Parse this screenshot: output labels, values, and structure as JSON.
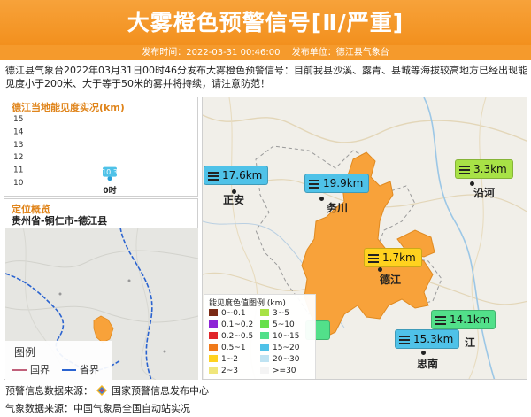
{
  "header": {
    "title": "大雾橙色预警信号[Ⅱ/严重]",
    "publish_time": "发布时间：2022-03-31 00:46:00",
    "publish_unit": "发布单位：德江县气象台"
  },
  "description": "德江县气象台2022年03月31日00时46分发布大雾橙色预警信号：目前我县沙溪、露青、县城等海拔较高地方已经出现能见度小于200米、大于等于50米的雾并将持续，请注意防范！",
  "visibility_panel": {
    "title": "德江当地能见度实况(km)",
    "chart_data": {
      "type": "line",
      "title": "德江当地能见度实况(km)",
      "categories": [
        "0时"
      ],
      "values": [
        10.3
      ],
      "yticks": [
        15,
        14,
        13,
        12,
        11,
        10
      ],
      "ylim": [
        10,
        15
      ],
      "grid": false
    }
  },
  "location_panel": {
    "title": "定位概览",
    "region": "贵州省-铜仁市-德江县",
    "legend_title": "图例",
    "legend_items": [
      {
        "label": "国界",
        "color": "#c0607a"
      },
      {
        "label": "省界",
        "color": "#2a63d0"
      }
    ]
  },
  "map_labels": [
    {
      "id": "zhengan",
      "value": "17.6km",
      "color": "#4fc2e8",
      "city": "正安"
    },
    {
      "id": "wuchuan",
      "value": "19.9km",
      "color": "#4fc2e8",
      "city": "务川"
    },
    {
      "id": "yanhe",
      "value": "3.3km",
      "color": "#a8e246",
      "city": "沿河"
    },
    {
      "id": "dejiang",
      "value": "1.7km",
      "color": "#ffd21f",
      "city": "德江"
    },
    {
      "id": "yinjiang",
      "value": "14.1km",
      "color": "#52e08a",
      "city": "印江"
    },
    {
      "id": "sinan",
      "value": "15.3km",
      "color": "#4fc2e8",
      "city": "思南"
    }
  ],
  "partial_city_text": "江",
  "vis_legend": {
    "title": "能见度色值图例 (km)",
    "items": [
      {
        "label": "0~0.1",
        "color": "#7b2a14"
      },
      {
        "label": "3~5",
        "color": "#a8e246"
      },
      {
        "label": "0.1~0.2",
        "color": "#8e24d6"
      },
      {
        "label": "5~10",
        "color": "#67e04a"
      },
      {
        "label": "0.2~0.5",
        "color": "#e0262a"
      },
      {
        "label": "10~15",
        "color": "#52e08a"
      },
      {
        "label": "0.5~1",
        "color": "#f07a1a"
      },
      {
        "label": "15~20",
        "color": "#4fc2e8"
      },
      {
        "label": "1~2",
        "color": "#ffd21f"
      },
      {
        "label": "20~30",
        "color": "#bfe3f2"
      },
      {
        "label": "2~3",
        "color": "#f0e67a"
      },
      {
        "label": ">=30",
        "color": "#f4f4f4"
      }
    ]
  },
  "footer": {
    "warning_source_label": "预警信息数据来源：",
    "warning_source_name": "国家预警信息发布中心",
    "weather_source": "气象数据来源：中国气象局全国自动站实况"
  },
  "colors": {
    "banner": "#f18a14",
    "warning_area": "#f8a23a",
    "accent_text": "#e0851c"
  },
  "icons": {
    "value_box": "equals-bars-icon",
    "cma": "cma-diamond-icon"
  }
}
